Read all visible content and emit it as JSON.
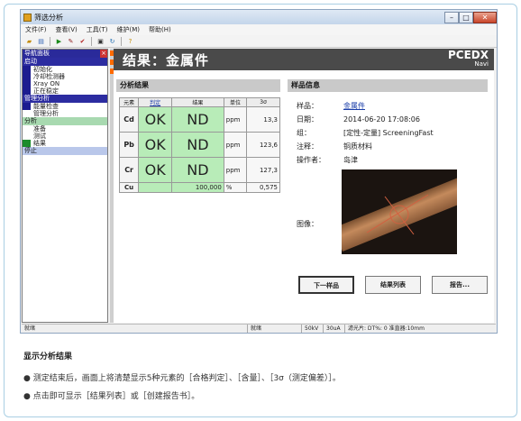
{
  "window": {
    "title": "筛选分析"
  },
  "menu": [
    "文件(F)",
    "查看(V)",
    "工具(T)",
    "维护(M)",
    "帮助(H)"
  ],
  "nav": {
    "title": "导航面板",
    "sections": [
      {
        "label": "启动",
        "style": "blue",
        "items": [
          {
            "label": "初始化",
            "mark": "blue"
          },
          {
            "label": "冷却检测器",
            "mark": "blue"
          },
          {
            "label": "Xray ON",
            "mark": "blue"
          },
          {
            "label": "正在稳定",
            "mark": "blue"
          }
        ]
      },
      {
        "label": "管理分析",
        "style": "blue",
        "items": [
          {
            "label": "能量检查",
            "mark": "blue"
          },
          {
            "label": "管理分析",
            "mark": ""
          }
        ]
      },
      {
        "label": "分析",
        "style": "green",
        "items": [
          {
            "label": "准备",
            "mark": ""
          },
          {
            "label": "测试",
            "mark": ""
          },
          {
            "label": "结果",
            "mark": "green"
          }
        ]
      },
      {
        "label": "停止",
        "style": "light",
        "items": []
      }
    ]
  },
  "header": {
    "title": "结果：金属件",
    "logo_main": "PCEDX",
    "logo_sub": "Navi"
  },
  "analysis": {
    "title": "分析结果",
    "columns": [
      "元素",
      "判定",
      "结果",
      "单位",
      "3σ"
    ],
    "rows": [
      {
        "element": "Cd",
        "judge": "OK",
        "result": "ND",
        "unit": "ppm",
        "sigma": "13,3"
      },
      {
        "element": "Pb",
        "judge": "OK",
        "result": "ND",
        "unit": "ppm",
        "sigma": "123,6"
      },
      {
        "element": "Cr",
        "judge": "OK",
        "result": "ND",
        "unit": "ppm",
        "sigma": "127,3"
      }
    ],
    "last_row": {
      "element": "Cu",
      "judge": "",
      "result": "100,000",
      "unit": "%",
      "sigma": "0,575"
    }
  },
  "sample": {
    "title": "样品信息",
    "name_label": "样品：",
    "name": "金属件",
    "date_label": "日期：",
    "date": "2014-06-20 17:08:06",
    "group_label": "组：",
    "group": "[定性-定量] ScreeningFast",
    "note_label": "注释：",
    "note": "铜质材料",
    "operator_label": "操作者：",
    "operator": "岛津",
    "image_label": "图像："
  },
  "buttons": {
    "next": "下一样品",
    "list": "结果列表",
    "report": "报告..."
  },
  "status": {
    "left": "就绪",
    "middle": "就绪",
    "kv": "50kV",
    "ua": "30uA",
    "filter": "滤光片: DT%: 0 准直器:10mm"
  },
  "caption": {
    "title": "显示分析结果",
    "line1": "● 测定结束后，画面上将清楚显示5种元素的［合格判定］、［含量］、［3σ（测定偏差）］。",
    "line2": "● 点击即可显示［结果列表］或［创建报告书］。"
  }
}
